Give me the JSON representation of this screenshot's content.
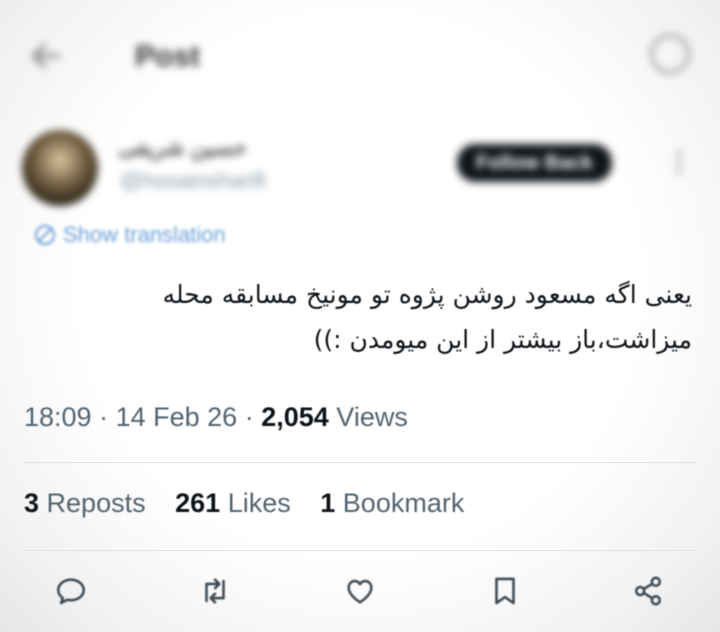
{
  "header": {
    "title": "Post",
    "back_icon": "arrow-left-icon",
    "right_icon": "grok-icon"
  },
  "author": {
    "display_name": "حسین شریفی",
    "handle": "@hosainsharifi",
    "follow_label": "Follow Back",
    "more_icon": "more-vertical-icon"
  },
  "translation": {
    "label": "Show translation",
    "icon": "globe-icon"
  },
  "tweet": {
    "line1": "یعنی اگه مسعود روشن پژوه تو مونیخ مسابقه محله",
    "line2": "میزاشت،باز بیشتر از این میومدن :))"
  },
  "meta": {
    "time": "18:09",
    "date": "14 Feb 26",
    "views_count": "2,054",
    "views_label": "Views"
  },
  "stats": {
    "reposts_count": "3",
    "reposts_label": "Reposts",
    "likes_count": "261",
    "likes_label": "Likes",
    "bookmarks_count": "1",
    "bookmarks_label": "Bookmark"
  },
  "actions": [
    "reply-icon",
    "repost-icon",
    "like-icon",
    "bookmark-icon",
    "share-icon"
  ],
  "colors": {
    "link": "#6aa0d8",
    "secondary_text": "#536471",
    "primary_text": "#0f1419"
  }
}
